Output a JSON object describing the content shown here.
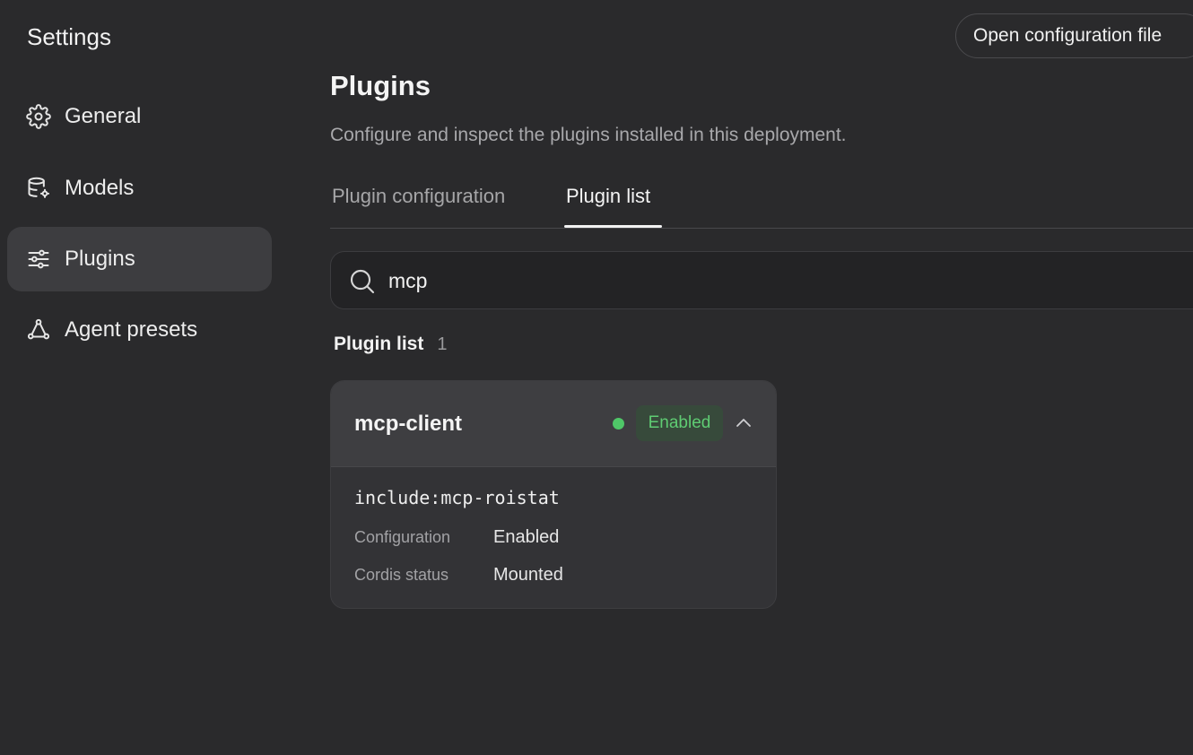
{
  "sidebar": {
    "title": "Settings",
    "items": [
      {
        "label": "General",
        "icon": "gear-icon",
        "active": false
      },
      {
        "label": "Models",
        "icon": "database-gear-icon",
        "active": false
      },
      {
        "label": "Plugins",
        "icon": "sliders-icon",
        "active": true
      },
      {
        "label": "Agent presets",
        "icon": "agent-network-icon",
        "active": false
      }
    ]
  },
  "header": {
    "open_config_label": "Open configuration file"
  },
  "main": {
    "title": "Plugins",
    "subtitle": "Configure and inspect the plugins installed in this deployment.",
    "tabs": [
      {
        "label": "Plugin configuration",
        "active": false
      },
      {
        "label": "Plugin list",
        "active": true
      }
    ],
    "search": {
      "value": "mcp",
      "placeholder": ""
    },
    "list_heading": "Plugin list",
    "list_count": "1",
    "plugins": [
      {
        "name": "mcp-client",
        "status": "Enabled",
        "status_color": "#4fc768",
        "include": "include:mcp-roistat",
        "config_label": "Configuration",
        "config_value": "Enabled",
        "cordis_label": "Cordis status",
        "cordis_value": "Mounted"
      }
    ]
  }
}
